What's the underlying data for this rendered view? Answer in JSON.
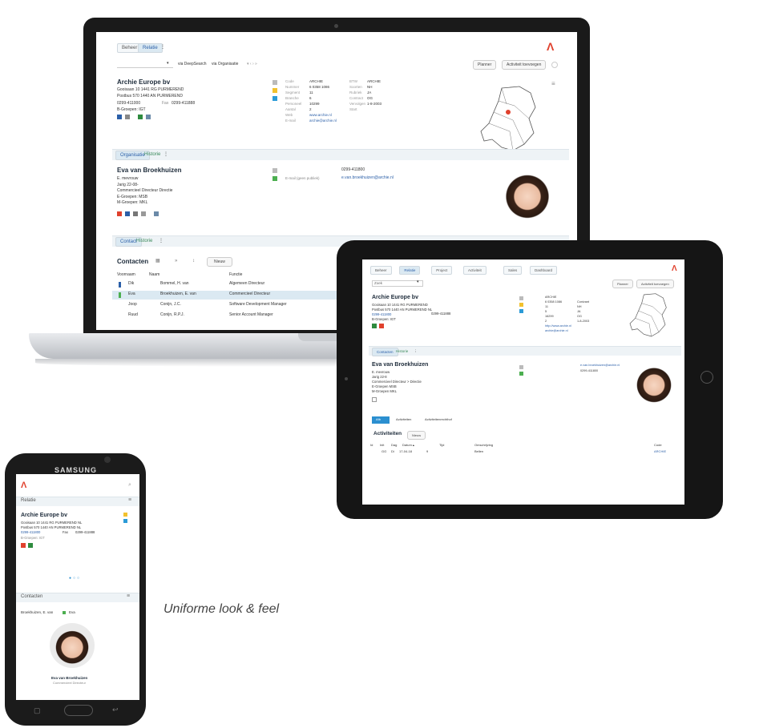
{
  "laptop": {
    "tabs": [
      "Beheer",
      "Relatie",
      "⋮"
    ],
    "search": {
      "value": "",
      "via1": "via DeepSearch",
      "via2": "via Organisatie"
    },
    "planner": "Planner",
    "add_activity": "Activiteit toevoegen",
    "org": {
      "name": "Archie Europe bv",
      "lines": [
        "Gooisaan 10 1441 RG PURMEREND",
        "Postbus 570 1440 AN PURMEREND",
        "0299-411000",
        "B-Groepen: IGT"
      ],
      "fax_label": "Fax",
      "fax": "0299-411888"
    },
    "fields_left_labels": [
      "Code",
      "Nummer",
      "Segment",
      "Branche",
      "Personeel",
      "Aantal",
      "Web",
      "E-mail"
    ],
    "fields_left_values": [
      "ARCHIE",
      "6 0358 1086",
      "11",
      "6",
      "10299",
      "2",
      "www.archie.nl",
      "archie@archie.nl"
    ],
    "fields_right_labels": [
      "BTW",
      "Soorten",
      "Rubriek",
      "Contract",
      "Vervolgen",
      "Start"
    ],
    "fields_right_values": [
      "",
      "ARCHIE",
      "NH",
      "JA",
      "OG",
      "1-8-2003"
    ],
    "org_tabs": [
      "Organisatie",
      "Historie",
      "⋮"
    ],
    "contact": {
      "name": "Eva van Broekhuizen",
      "lines": [
        "E. mevrouw",
        "Jarig 22-08-",
        "Commercieel Directeur Directie",
        "E-Groepen: MSB",
        "M-Groepen: MKL"
      ],
      "phone": "0299-411800",
      "email_label": "E-mail (geen publiek)",
      "email": "e.van.broekhuizen@archie.nl"
    },
    "contact_tabs": [
      "Contact",
      "Historie",
      "⋮"
    ],
    "contacts_title": "Contacten",
    "new_button": "Nieuw",
    "table_headers": [
      "Voornaam",
      "Naam",
      "Functie"
    ],
    "rows": [
      {
        "first": "Dik",
        "last": "Bommel, H. van",
        "role": "Algemeen Directeur",
        "color": "#2b5fa8"
      },
      {
        "first": "Eva",
        "last": "Broekhuizen, E. van",
        "role": "Commercieel Directeur",
        "color": "#4caf50"
      },
      {
        "first": "Joop",
        "last": "Conijn, J.C.",
        "role": "Software Development Manager",
        "color": ""
      },
      {
        "first": "Ruud",
        "last": "Conijn, R.P.J.",
        "role": "Senior Account Manager",
        "color": ""
      }
    ]
  },
  "tablet": {
    "tabs": [
      "Beheer",
      "Relatie",
      "Project",
      "Activiteit",
      "Sales",
      "Dashboard"
    ],
    "search_value": "Zoek",
    "planner": "Planner",
    "add_activity": "Activiteit toevoegen",
    "org": {
      "name": "Archie Europe bv",
      "lines": [
        "Gooisaan 10 1441 RG PURMEREND",
        "Postbus 570 1440 AN PURMEREND NL",
        "0299-411800",
        "B-Groepen: IGT"
      ],
      "fax": "0299-411888"
    },
    "fields_values": [
      "ARCHIE",
      "6 0358 1086",
      "11",
      "5",
      "16299",
      "2",
      "http://www.archie.nl",
      "archie@archie.nl"
    ],
    "fields_right_values": [
      "Conivant",
      "NH",
      "JA",
      "OG",
      "1-8-2003"
    ],
    "contact_tabs": [
      "Contacten",
      "Historie",
      "⋮"
    ],
    "contact": {
      "name": "Eva van Broekhuizen",
      "lines": [
        "E.  mevrouw",
        "Jarig  22-8",
        "Commercieel Directeur  >  Directie",
        "E-Groepen MSB",
        "M-Groepen MKL"
      ],
      "email": "e.van.broekhuizen@archie.nl",
      "phone": "0299-411800"
    },
    "bottom_tabs": [
      "Afb",
      "Activiteiten",
      "Activiteitenrechthof"
    ],
    "activities_title": "Activiteiten",
    "new_button": "Nieuw",
    "table_headers": [
      "Id",
      "Init",
      "Dag",
      "Datum ▴",
      "Tijd",
      "Omschrijving",
      "Code"
    ],
    "activity_row": [
      "",
      "GG",
      "Di",
      "17-04-18",
      "9",
      "",
      "Bellen",
      "ARCHIE"
    ]
  },
  "phone": {
    "brand": "SAMSUNG",
    "section": "Relatie",
    "org": {
      "name": "Archie Europe bv",
      "lines": [
        "Gooisaan 10 1441 RG PURMEREND NL",
        "Postbus 570 1440 AN PURMEREND NL"
      ],
      "phone": "0299-411800",
      "fax_label": "Fax",
      "fax": "0299-411888",
      "group": "B-Groepen: IGT"
    },
    "contacts_title": "Contacten",
    "contact_row": [
      "Broekhuizen, E. van",
      "Eva"
    ],
    "contact_name": "Eva van Broekhuizen",
    "contact_role": "Commercieel Directeur"
  },
  "caption": "Uniforme look & feel",
  "colors": {
    "accent": "#2b5fa8",
    "brand_red": "#e0412d",
    "selected_row": "#dbe9f2"
  }
}
